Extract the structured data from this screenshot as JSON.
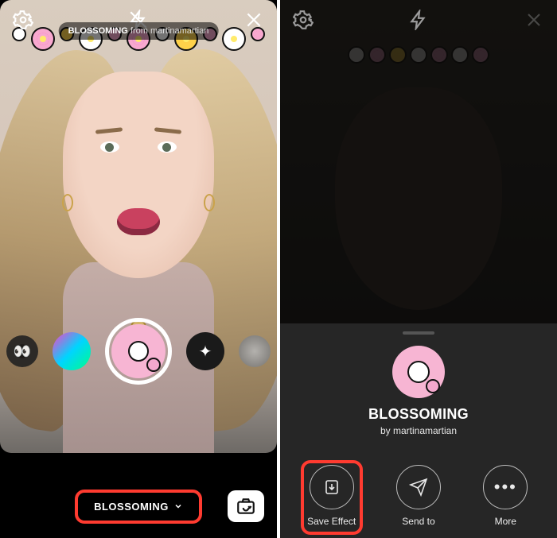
{
  "left": {
    "filter_tag": {
      "name": "BLOSSOMING",
      "from_word": "from",
      "author": "martinamartian"
    },
    "bottom_label": "BLOSSOMING",
    "carousel_selected": "blossoming"
  },
  "right": {
    "sheet": {
      "title": "BLOSSOMING",
      "by_word": "by",
      "author": "martinamartian",
      "actions": {
        "save": "Save Effect",
        "send": "Send to",
        "more": "More"
      }
    }
  },
  "icons": {
    "settings": "settings-icon",
    "flash": "flash-icon",
    "close": "close-icon",
    "flip": "flip-camera-icon",
    "save": "save-icon",
    "send": "send-icon",
    "more": "more-icon"
  }
}
